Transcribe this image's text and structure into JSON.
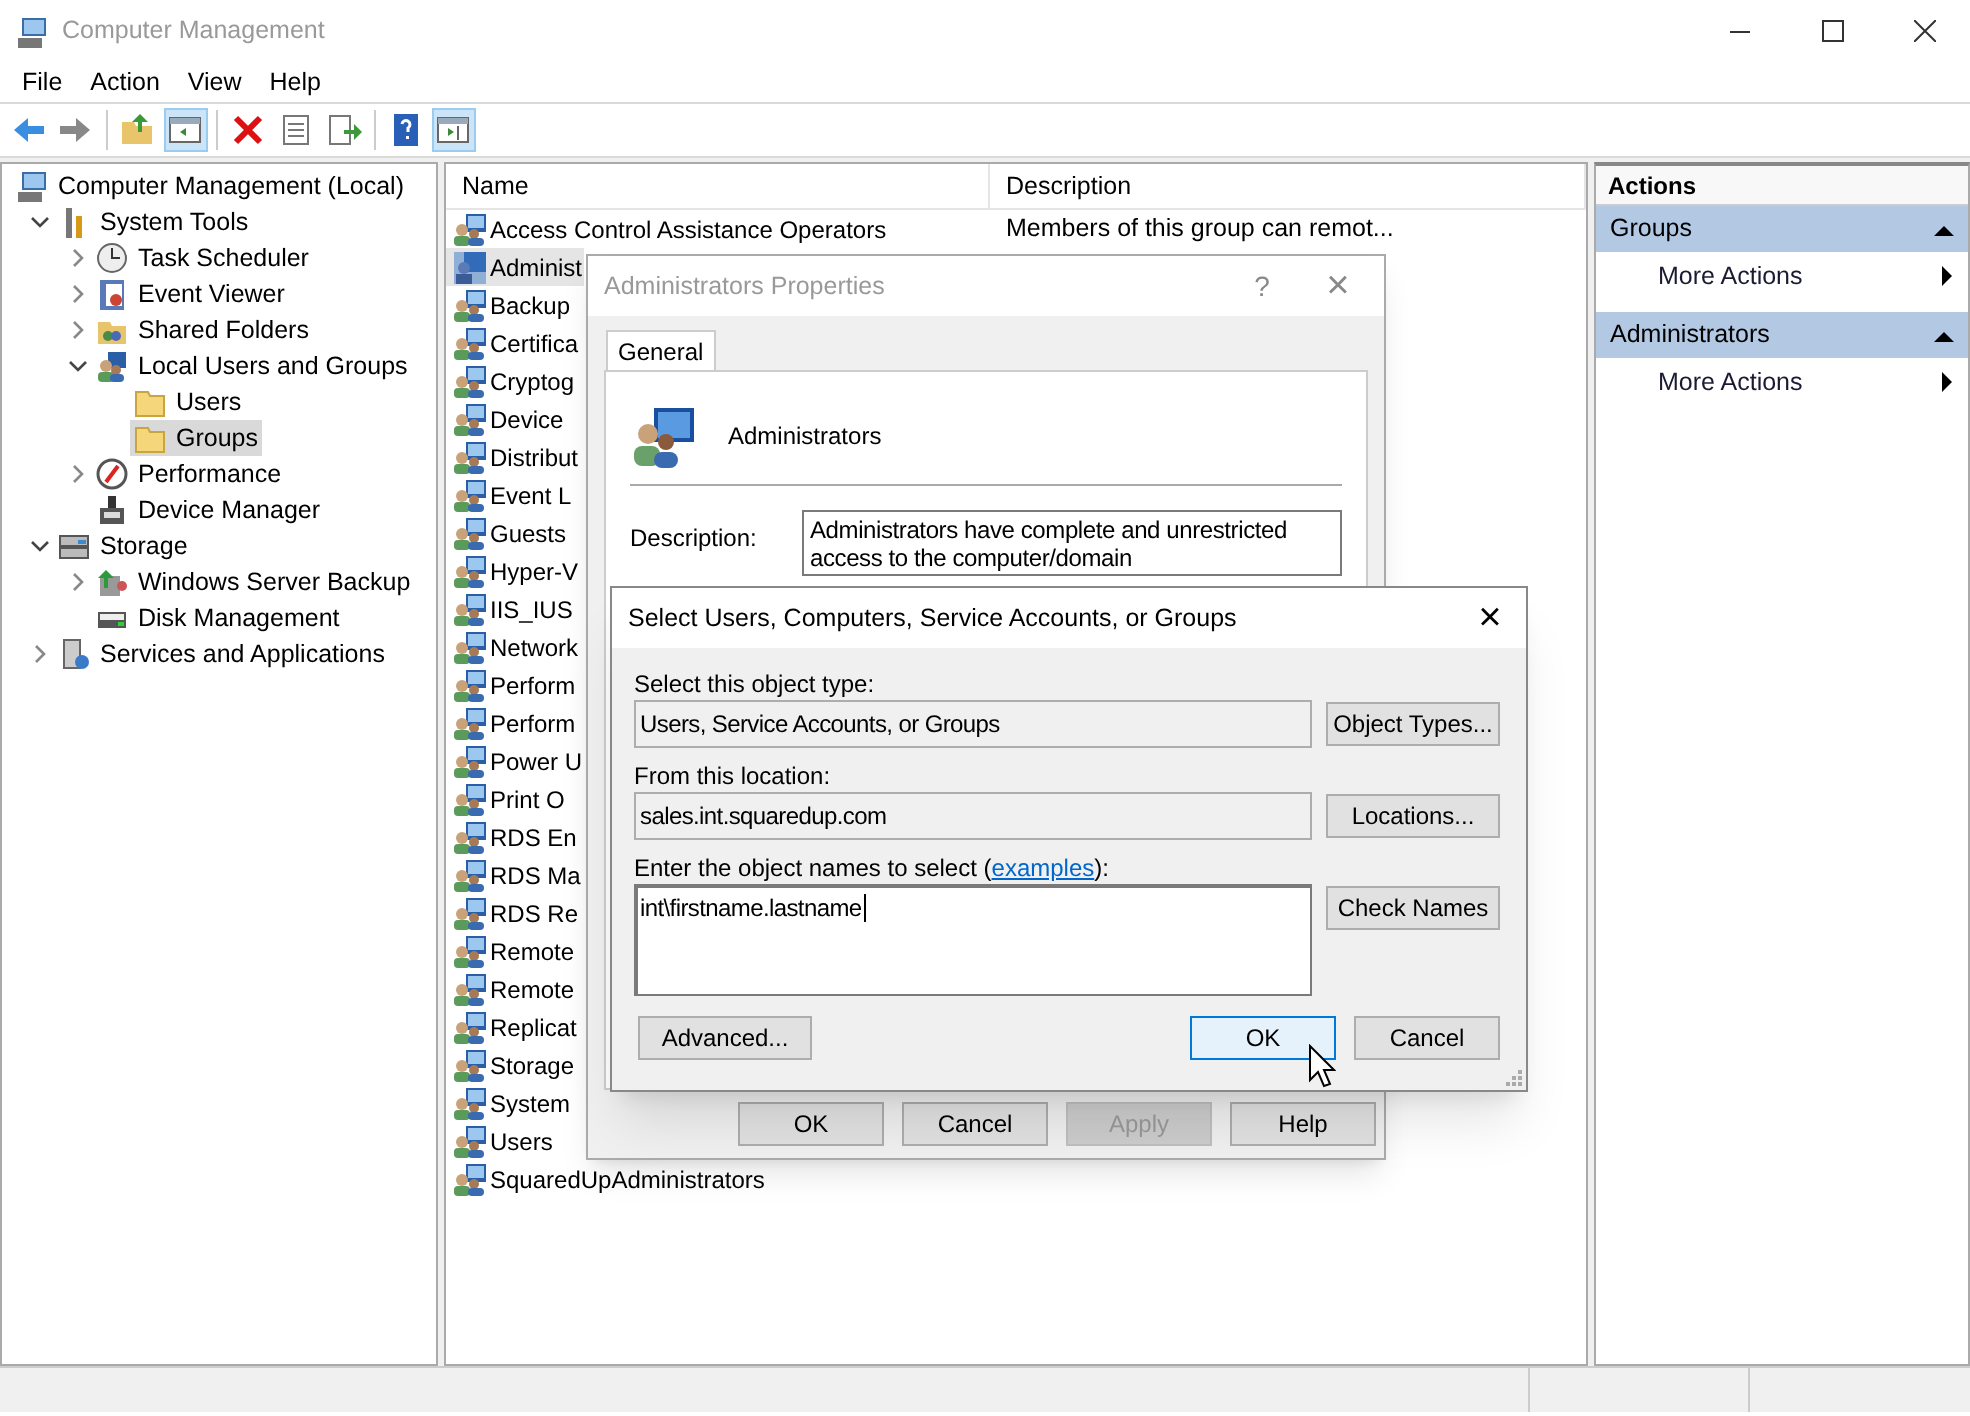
{
  "window": {
    "title": "Computer Management"
  },
  "menu": [
    "File",
    "Action",
    "View",
    "Help"
  ],
  "toolbar": [
    {
      "kind": "back",
      "pressed": false
    },
    {
      "kind": "forward",
      "pressed": false
    },
    {
      "kind": "sep"
    },
    {
      "kind": "up",
      "pressed": false
    },
    {
      "kind": "tree",
      "pressed": true
    },
    {
      "kind": "sep"
    },
    {
      "kind": "delete",
      "pressed": false
    },
    {
      "kind": "properties",
      "pressed": false
    },
    {
      "kind": "export",
      "pressed": false
    },
    {
      "kind": "sep"
    },
    {
      "kind": "help",
      "pressed": false
    },
    {
      "kind": "pane",
      "pressed": true
    }
  ],
  "tree": [
    {
      "label": "Computer Management (Local)",
      "kind": "computer",
      "selected": false,
      "children": [
        {
          "label": "System Tools",
          "kind": "tools",
          "expanded": true,
          "selected": false,
          "children": [
            {
              "label": "Task Scheduler",
              "kind": "clock",
              "expanded": false,
              "selected": false
            },
            {
              "label": "Event Viewer",
              "kind": "log",
              "expanded": false,
              "selected": false
            },
            {
              "label": "Shared Folders",
              "kind": "share",
              "expanded": false,
              "selected": false
            },
            {
              "label": "Local Users and Groups",
              "kind": "users",
              "expanded": true,
              "selected": false,
              "children": [
                {
                  "label": "Users",
                  "kind": "folder",
                  "selected": false
                },
                {
                  "label": "Groups",
                  "kind": "folder",
                  "selected": true
                }
              ]
            },
            {
              "label": "Performance",
              "kind": "gauge",
              "expanded": false,
              "selected": false
            },
            {
              "label": "Device Manager",
              "kind": "device",
              "selected": false
            }
          ]
        },
        {
          "label": "Storage",
          "kind": "storage",
          "expanded": true,
          "selected": false,
          "children": [
            {
              "label": "Windows Server Backup",
              "kind": "backup",
              "expanded": false,
              "selected": false
            },
            {
              "label": "Disk Management",
              "kind": "disk",
              "selected": false
            }
          ]
        },
        {
          "label": "Services and Applications",
          "kind": "services",
          "expanded": false,
          "selected": false
        }
      ]
    }
  ],
  "list": {
    "columns": [
      "Name",
      "Description"
    ],
    "rows": [
      {
        "name": "Access Control Assistance Operators",
        "description": "Members of this group can remot...",
        "selected": false
      },
      {
        "name": "Administ",
        "selected": true
      },
      {
        "name": "Backup",
        "selected": false
      },
      {
        "name": "Certifica",
        "selected": false
      },
      {
        "name": "Cryptog",
        "selected": false
      },
      {
        "name": "Device",
        "selected": false
      },
      {
        "name": "Distribut",
        "selected": false
      },
      {
        "name": "Event L",
        "selected": false
      },
      {
        "name": "Guests",
        "selected": false
      },
      {
        "name": "Hyper-V",
        "selected": false
      },
      {
        "name": "IIS_IUS",
        "selected": false
      },
      {
        "name": "Network",
        "selected": false
      },
      {
        "name": "Perform",
        "selected": false
      },
      {
        "name": "Perform",
        "selected": false
      },
      {
        "name": "Power U",
        "selected": false
      },
      {
        "name": "Print O",
        "selected": false
      },
      {
        "name": "RDS En",
        "selected": false
      },
      {
        "name": "RDS Ma",
        "selected": false
      },
      {
        "name": "RDS Re",
        "selected": false
      },
      {
        "name": "Remote",
        "selected": false
      },
      {
        "name": "Remote",
        "selected": false
      },
      {
        "name": "Replicat",
        "selected": false
      },
      {
        "name": "Storage",
        "selected": false
      },
      {
        "name": "System",
        "selected": false
      },
      {
        "name": "Users",
        "selected": false
      },
      {
        "name": "SquaredUpAdministrators",
        "selected": false
      }
    ]
  },
  "actions": {
    "title": "Actions",
    "sections": [
      {
        "title": "Groups",
        "items": [
          "More Actions"
        ]
      },
      {
        "title": "Administrators",
        "items": [
          "More Actions"
        ]
      }
    ]
  },
  "properties_dialog": {
    "title": "Administrators Properties",
    "help": "?",
    "close": "×",
    "tabs": [
      {
        "label": "General",
        "selected": true
      }
    ],
    "group_name": "Administrators",
    "description_label": "Description:",
    "description": "Administrators have complete and unrestricted access to the computer/domain",
    "buttons": [
      {
        "label": "OK",
        "disabled": false
      },
      {
        "label": "Cancel",
        "disabled": false
      },
      {
        "label": "Apply",
        "disabled": true
      },
      {
        "label": "Help",
        "disabled": false
      }
    ]
  },
  "select_dialog": {
    "title": "Select Users, Computers, Service Accounts, or Groups",
    "close": "×",
    "object_type_label": "Select this object type:",
    "object_type": "Users, Service Accounts, or Groups",
    "object_types_button": "Object Types...",
    "location_label": "From this location:",
    "location": "sales.int.squaredup.com",
    "locations_button": "Locations...",
    "names_prompt": {
      "before": "Enter the object names to select (",
      "link": "examples",
      "after": "):"
    },
    "names_value": "int\\firstname.lastname",
    "check_names_button": "Check Names",
    "advanced_button": "Advanced...",
    "ok": {
      "label": "OK",
      "focused": true
    },
    "cancel": {
      "label": "Cancel",
      "focused": false
    }
  }
}
